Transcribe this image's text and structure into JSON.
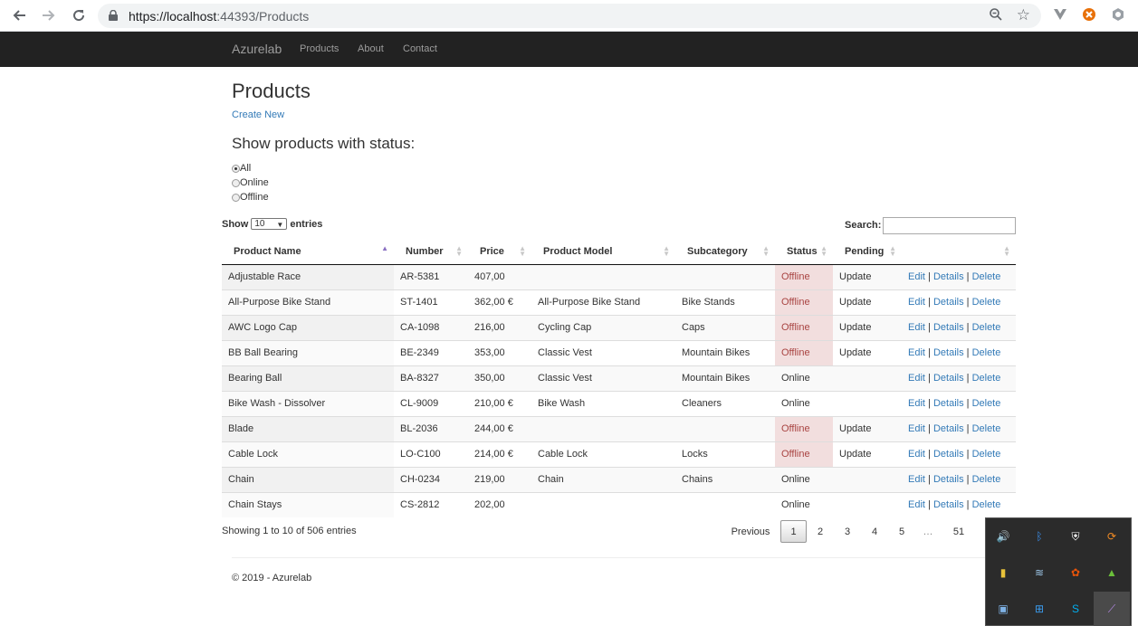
{
  "browser": {
    "url_host": "https://localhost",
    "url_rest": ":44393/Products"
  },
  "navbar": {
    "brand": "Azurelab",
    "links": [
      "Products",
      "About",
      "Contact"
    ]
  },
  "page": {
    "title": "Products",
    "create_link": "Create New",
    "filter_title": "Show products with status:",
    "filter_options": [
      {
        "label": "All",
        "selected": true
      },
      {
        "label": "Online",
        "selected": false
      },
      {
        "label": "Offline",
        "selected": false
      }
    ]
  },
  "table_controls": {
    "show": "Show",
    "length_value": "10",
    "entries": "entries",
    "search_label": "Search:"
  },
  "table": {
    "columns": [
      "Product Name",
      "Number",
      "Price",
      "Product Model",
      "Subcategory",
      "Status",
      "Pending",
      ""
    ],
    "rows": [
      {
        "name": "Adjustable Race",
        "number": "AR-5381",
        "price": "407,00",
        "model": "",
        "subcategory": "",
        "status": "Offline",
        "pending": "Update"
      },
      {
        "name": "All-Purpose Bike Stand",
        "number": "ST-1401",
        "price": "362,00 €",
        "model": "All-Purpose Bike Stand",
        "subcategory": "Bike Stands",
        "status": "Offline",
        "pending": "Update"
      },
      {
        "name": "AWC Logo Cap",
        "number": "CA-1098",
        "price": "216,00",
        "model": "Cycling Cap",
        "subcategory": "Caps",
        "status": "Offline",
        "pending": "Update"
      },
      {
        "name": "BB Ball Bearing",
        "number": "BE-2349",
        "price": "353,00",
        "model": "Classic Vest",
        "subcategory": "Mountain Bikes",
        "status": "Offline",
        "pending": "Update"
      },
      {
        "name": "Bearing Ball",
        "number": "BA-8327",
        "price": "350,00",
        "model": "Classic Vest",
        "subcategory": "Mountain Bikes",
        "status": "Online",
        "pending": ""
      },
      {
        "name": "Bike Wash - Dissolver",
        "number": "CL-9009",
        "price": "210,00 €",
        "model": "Bike Wash",
        "subcategory": "Cleaners",
        "status": "Online",
        "pending": ""
      },
      {
        "name": "Blade",
        "number": "BL-2036",
        "price": "244,00 €",
        "model": "",
        "subcategory": "",
        "status": "Offline",
        "pending": "Update"
      },
      {
        "name": "Cable Lock",
        "number": "LO-C100",
        "price": "214,00 €",
        "model": "Cable Lock",
        "subcategory": "Locks",
        "status": "Offline",
        "pending": "Update"
      },
      {
        "name": "Chain",
        "number": "CH-0234",
        "price": "219,00",
        "model": "Chain",
        "subcategory": "Chains",
        "status": "Online",
        "pending": ""
      },
      {
        "name": "Chain Stays",
        "number": "CS-2812",
        "price": "202,00",
        "model": "",
        "subcategory": "",
        "status": "Online",
        "pending": ""
      }
    ],
    "actions": {
      "edit": "Edit",
      "details": "Details",
      "delete": "Delete",
      "sep": "|"
    }
  },
  "pagination": {
    "info": "Showing 1 to 10 of 506 entries",
    "previous": "Previous",
    "pages": [
      "1",
      "2",
      "3",
      "4",
      "5",
      "…",
      "51"
    ],
    "current": "1"
  },
  "footer": {
    "text": "© 2019 - Azurelab"
  },
  "tray_icons": [
    "speaker-icon",
    "bluetooth-icon",
    "shield-icon",
    "sync-icon",
    "folder-icon",
    "database-icon",
    "flower-icon",
    "drive-icon",
    "monitor-icon",
    "windows-icon",
    "skype-icon",
    "feather-icon"
  ]
}
